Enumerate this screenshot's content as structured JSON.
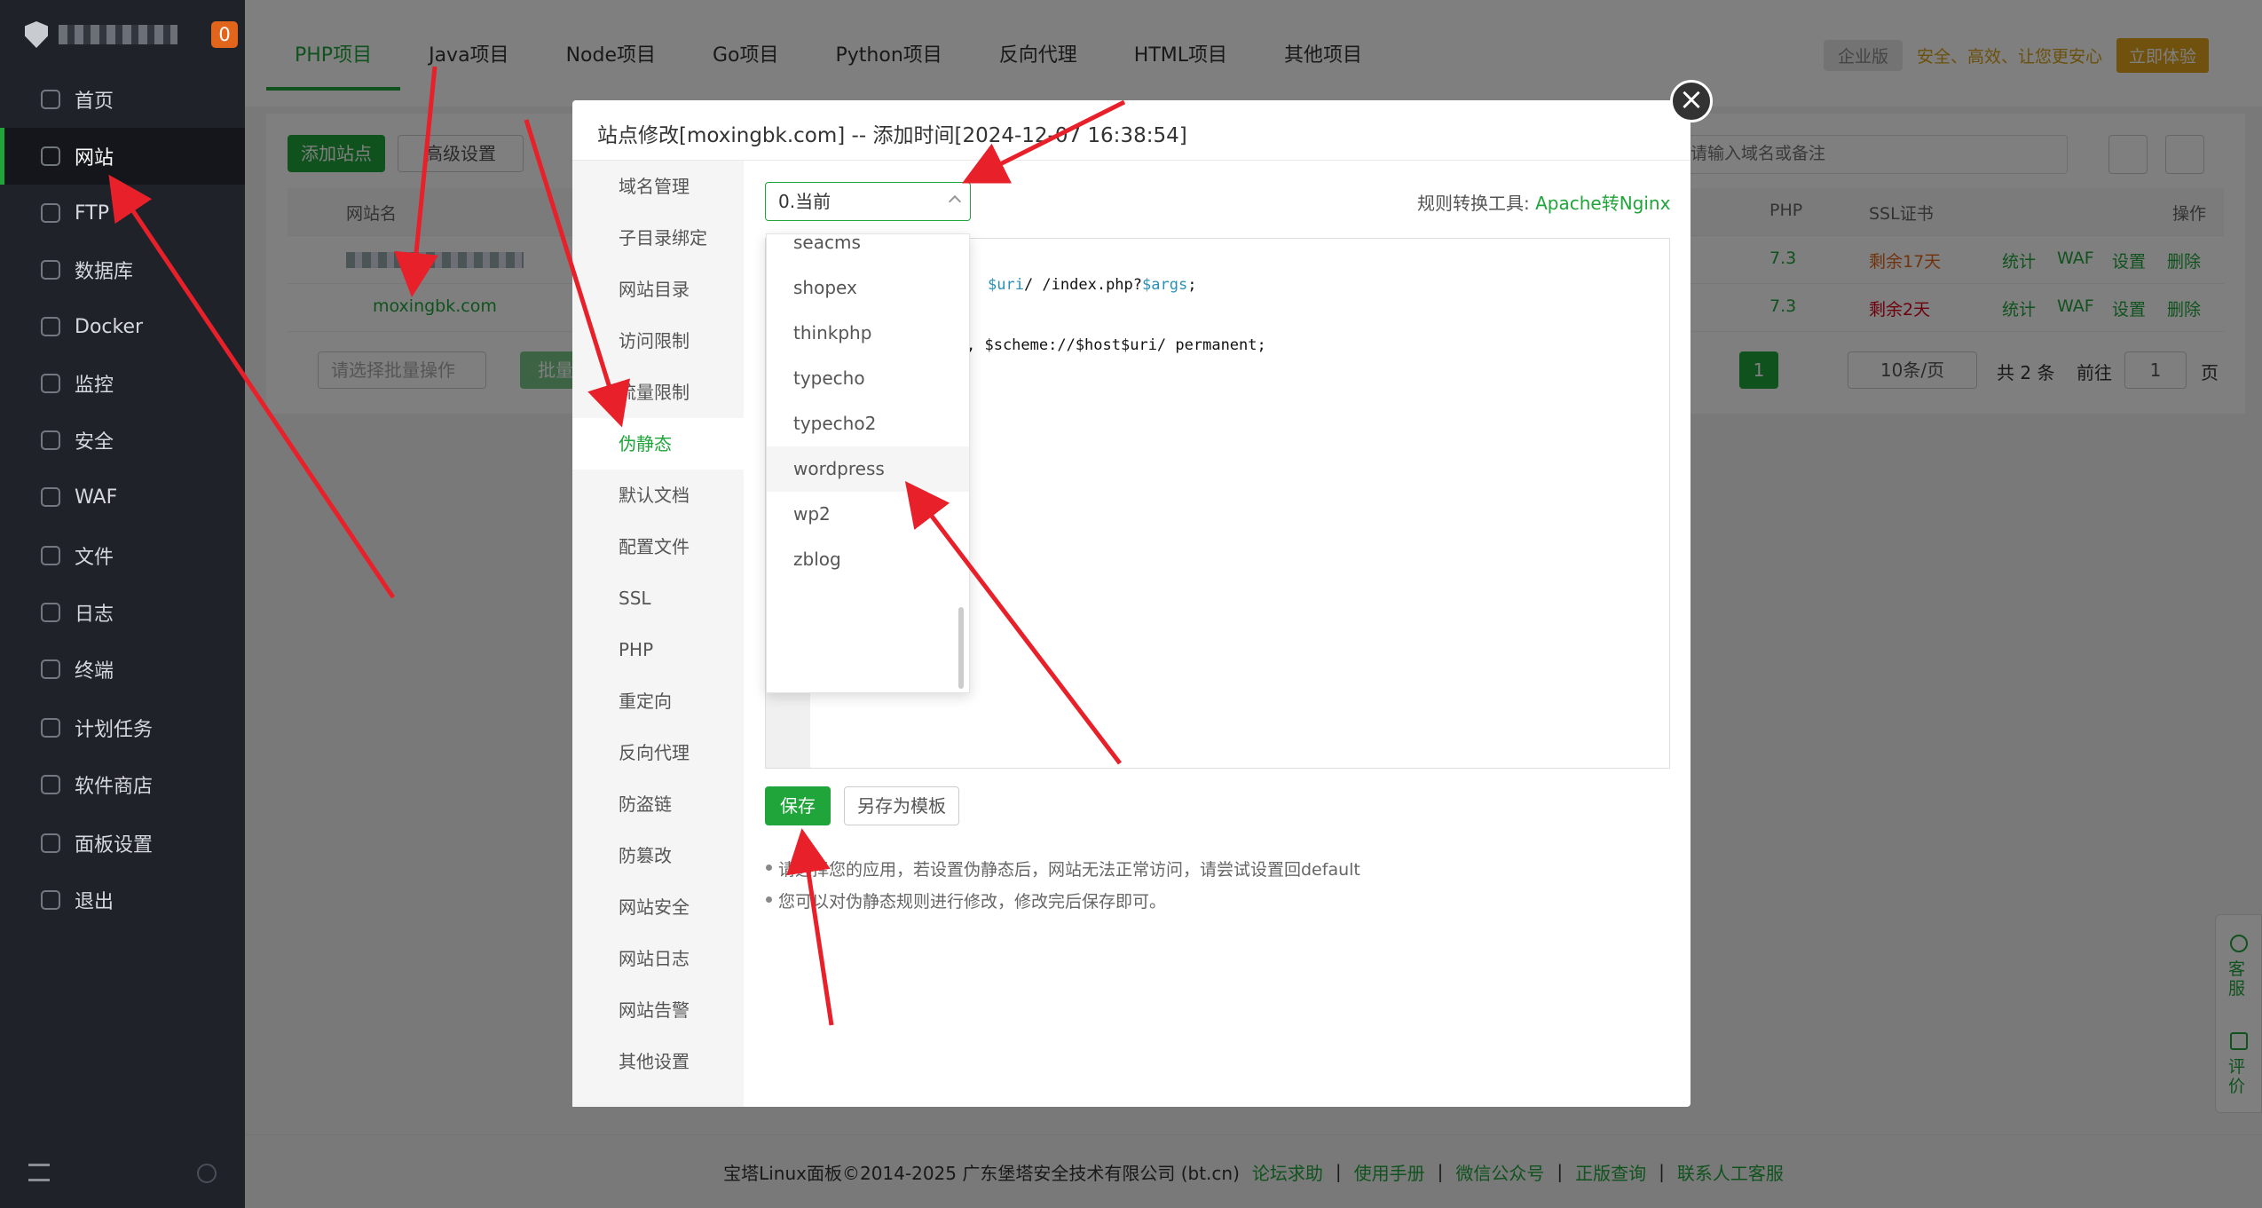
{
  "sidebar": {
    "badge": "0",
    "items": [
      {
        "label": "首页",
        "icon": "home-icon"
      },
      {
        "label": "网站",
        "icon": "globe-icon",
        "active": true
      },
      {
        "label": "FTP",
        "icon": "ftp-icon"
      },
      {
        "label": "数据库",
        "icon": "database-icon"
      },
      {
        "label": "Docker",
        "icon": "docker-icon"
      },
      {
        "label": "监控",
        "icon": "monitor-icon"
      },
      {
        "label": "安全",
        "icon": "shield-icon"
      },
      {
        "label": "WAF",
        "icon": "waf-icon"
      },
      {
        "label": "文件",
        "icon": "folder-icon"
      },
      {
        "label": "日志",
        "icon": "log-icon"
      },
      {
        "label": "终端",
        "icon": "terminal-icon"
      },
      {
        "label": "计划任务",
        "icon": "calendar-icon"
      },
      {
        "label": "软件商店",
        "icon": "store-icon"
      },
      {
        "label": "面板设置",
        "icon": "gear-icon"
      },
      {
        "label": "退出",
        "icon": "logout-icon"
      }
    ]
  },
  "tabs": [
    "PHP项目",
    "Java项目",
    "Node项目",
    "Go项目",
    "Python项目",
    "反向代理",
    "HTML项目",
    "其他项目"
  ],
  "promo": {
    "edition": "企业版",
    "text": "安全、高效、让您更安心",
    "cta": "立即体验"
  },
  "toolbar": {
    "add_site": "添加站点",
    "advanced": "高级设置",
    "search_placeholder": "请输入域名或备注"
  },
  "table": {
    "headers": {
      "name": "网站名",
      "php": "PHP",
      "ssl": "SSL证书",
      "ops": "操作"
    },
    "rows": [
      {
        "name": "",
        "php": "7.3",
        "ssl": "剩余17天",
        "actions": [
          "统计",
          "WAF",
          "设置",
          "删除"
        ]
      },
      {
        "name": "moxingbk.com",
        "php": "7.3",
        "ssl": "剩余2天",
        "actions": [
          "统计",
          "WAF",
          "设置",
          "删除"
        ]
      }
    ],
    "batch_placeholder": "请选择批量操作",
    "batch_button": "批量",
    "page_current": "1",
    "page_size": "10条/页",
    "total": "共 2 条",
    "goto_label": "前往",
    "goto_value": "1",
    "page_suffix": "页"
  },
  "modal": {
    "title": "站点修改[moxingbk.com] -- 添加时间[2024-12-07 16:38:54]",
    "nav": [
      "域名管理",
      "子目录绑定",
      "网站目录",
      "访问限制",
      "流量限制",
      "伪静态",
      "默认文档",
      "配置文件",
      "SSL",
      "PHP",
      "重定向",
      "反向代理",
      "防盗链",
      "防篡改",
      "网站安全",
      "网站日志",
      "网站告警",
      "其他设置"
    ],
    "active_nav": "伪静态",
    "select_value": "0.当前",
    "converter_label": "规则转换工具:",
    "converter_link": "Apache转Nginx",
    "code_line1_var": "$uri",
    "code_line1_rest": "/ /index.php?",
    "code_line1_var2": "$args",
    "code_line1_end": ";",
    "code_line2": ", $scheme://$host$uri/ permanent;",
    "dropdown_options": [
      "seacms",
      "shopex",
      "thinkphp",
      "typecho",
      "typecho2",
      "wordpress",
      "wp2",
      "zblog"
    ],
    "highlighted_option": "wordpress",
    "save_button": "保存",
    "save_template_button": "另存为模板",
    "help": [
      "请选择您的应用，若设置伪静态后，网站无法正常访问，请尝试设置回default",
      "您可以对伪静态规则进行修改，修改完后保存即可。"
    ]
  },
  "footer": {
    "copyright": "宝塔Linux面板©2014-2025 广东堡塔安全技术有限公司 (bt.cn)",
    "links": [
      "论坛求助",
      "使用手册",
      "微信公众号",
      "正版查询",
      "联系人工客服"
    ]
  },
  "float": {
    "service": "客服",
    "review": "评价"
  },
  "colors": {
    "accent": "#20a53a",
    "sidebar": "#1f2229",
    "annotation_arrow": "#e8202a",
    "ssl_warn": "#e2651c",
    "ssl_danger": "#d9001b"
  }
}
